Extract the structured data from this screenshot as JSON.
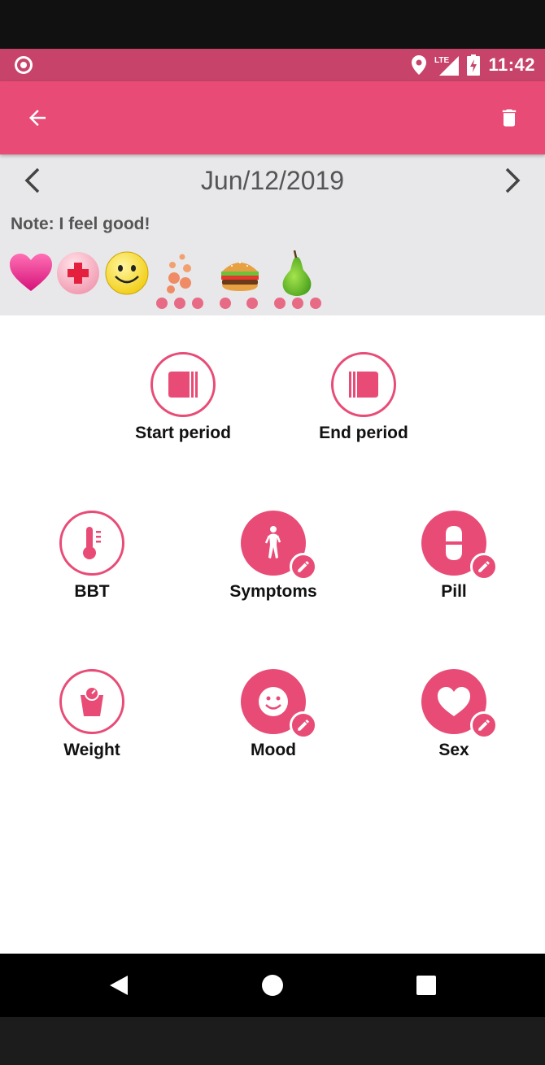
{
  "status_bar": {
    "time": "11:42",
    "network": "LTE"
  },
  "app_bar": {
    "back_icon": "arrow-left-icon",
    "delete_icon": "trash-icon"
  },
  "date_nav": {
    "date": "Jun/12/2019",
    "prev_icon": "chevron-left-icon",
    "next_icon": "chevron-right-icon"
  },
  "note": "Note: I feel good!",
  "logged_icons": [
    "heart-icon",
    "medicine-icon",
    "smiley-icon",
    "pimples-icon",
    "burger-icon",
    "pear-icon"
  ],
  "period": {
    "start_label": "Start period",
    "end_label": "End period"
  },
  "trackers": {
    "bbt_label": "BBT",
    "symptoms_label": "Symptoms",
    "pill_label": "Pill",
    "weight_label": "Weight",
    "mood_label": "Mood",
    "sex_label": "Sex"
  },
  "colors": {
    "accent": "#e84c76",
    "status_bar": "#c7436a",
    "date_bar_bg": "#e8e8ea"
  }
}
